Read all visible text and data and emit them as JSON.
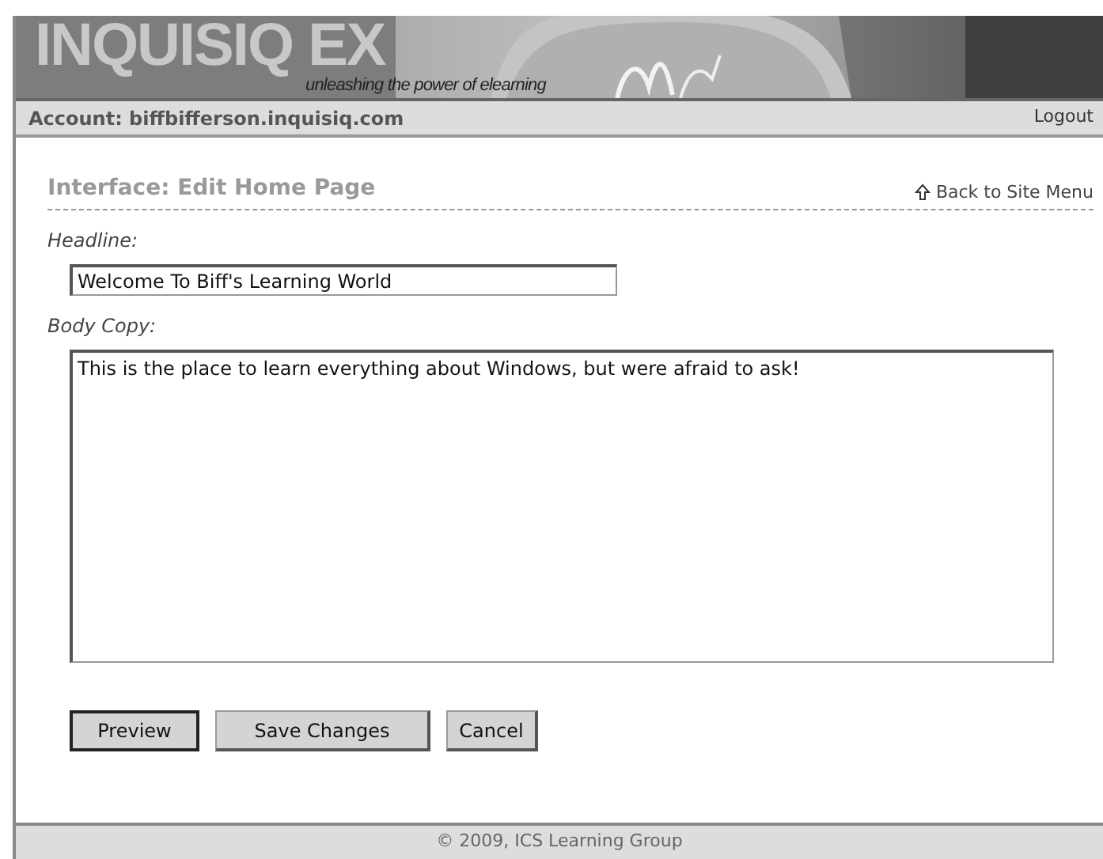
{
  "banner": {
    "logo": "INQUISIQ EX",
    "tagline": "unleashing the power of elearning"
  },
  "account_bar": {
    "account": "Account: biffbifferson.inquisiq.com",
    "logout": "Logout"
  },
  "page": {
    "title": "Interface: Edit Home Page",
    "back_link": "Back to Site Menu"
  },
  "form": {
    "headline_label": "Headline:",
    "headline_value": "Welcome To Biff's Learning World",
    "body_label": "Body Copy:",
    "body_value": "This is the place to learn everything about Windows, but were afraid to ask!"
  },
  "buttons": [
    {
      "label": "Preview",
      "focused": true
    },
    {
      "label": "Save Changes",
      "focused": false
    },
    {
      "label": "Cancel",
      "focused": false
    }
  ],
  "footer": "© 2009, ICS Learning Group"
}
